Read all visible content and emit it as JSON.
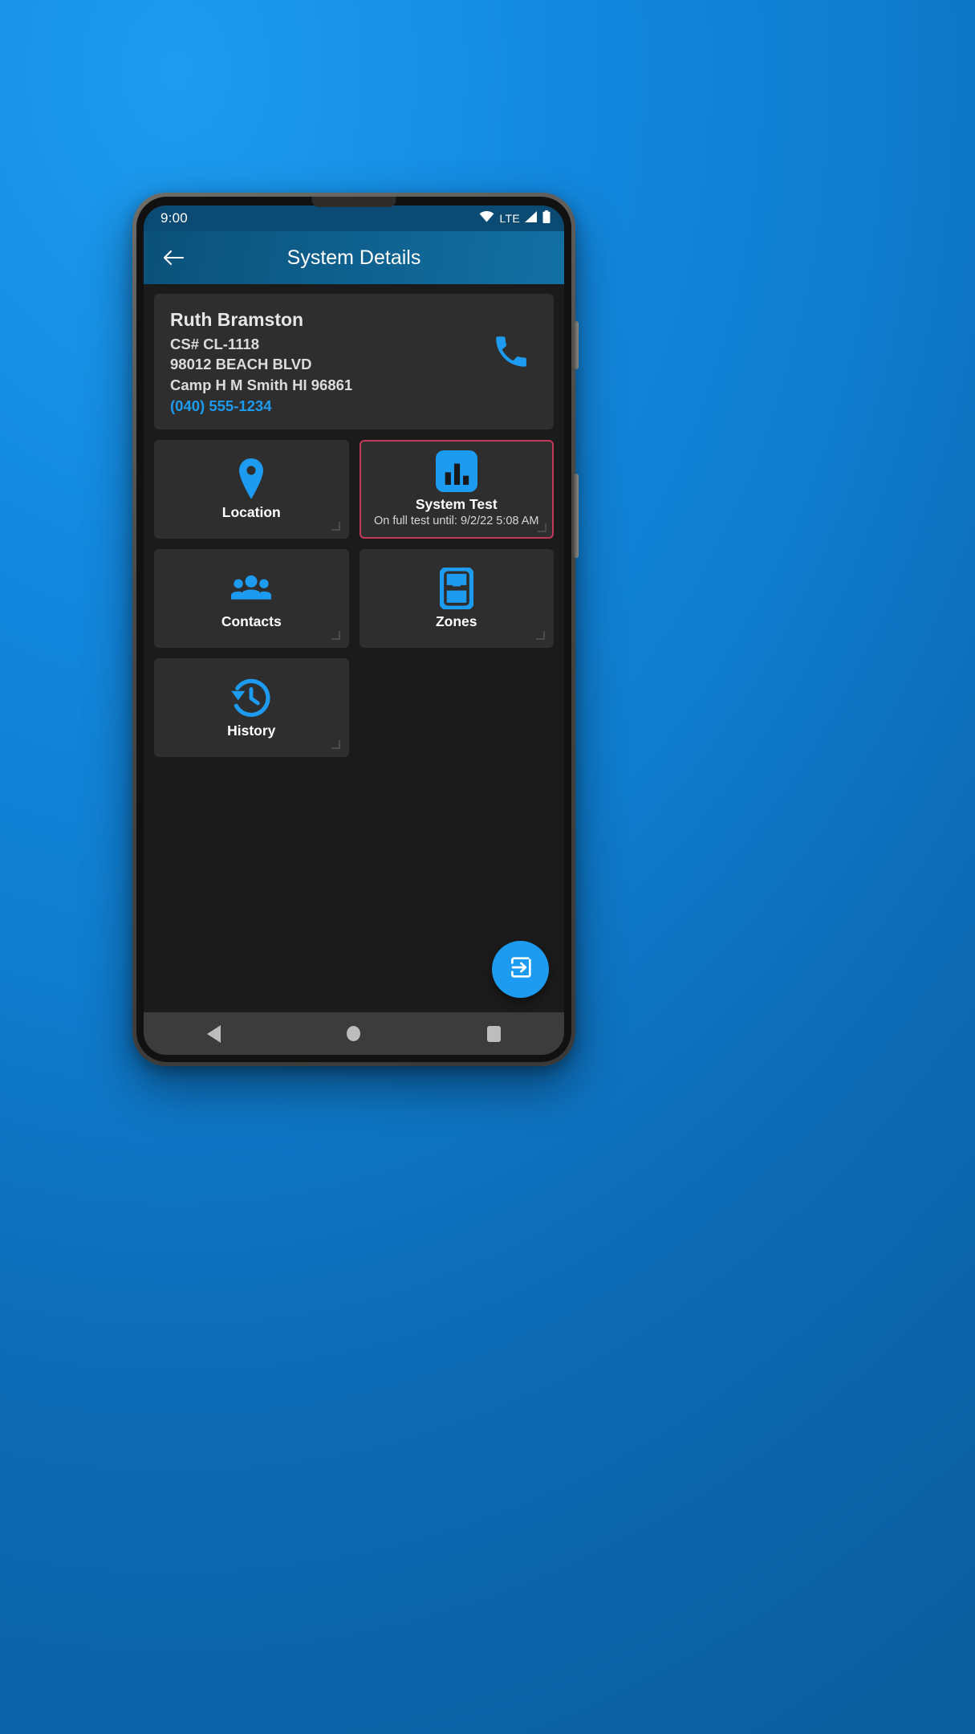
{
  "status_bar": {
    "time": "9:00",
    "network_label": "LTE",
    "icons": [
      "wifi-icon",
      "signal-icon",
      "battery-icon"
    ]
  },
  "app_bar": {
    "back_label": "back-arrow-icon",
    "title": "System Details"
  },
  "customer_card": {
    "name": "Ruth Bramston",
    "cs_number": "CS# CL-1118",
    "address_line1": "98012 BEACH BLVD",
    "address_line2": "Camp H M Smith HI 96861",
    "phone": "(040) 555-1234",
    "call_icon": "phone-icon"
  },
  "tiles": [
    {
      "id": "location",
      "label": "Location",
      "icon": "map-pin-icon",
      "subtitle": "",
      "alert": false
    },
    {
      "id": "system-test",
      "label": "System Test",
      "icon": "bar-chart-icon",
      "subtitle": "On full test until: 9/2/22 5:08 AM",
      "alert": true
    },
    {
      "id": "contacts",
      "label": "Contacts",
      "icon": "people-group-icon",
      "subtitle": "",
      "alert": false
    },
    {
      "id": "zones",
      "label": "Zones",
      "icon": "door-sensor-icon",
      "subtitle": "",
      "alert": false
    },
    {
      "id": "history",
      "label": "History",
      "icon": "history-clock-icon",
      "subtitle": "",
      "alert": false
    }
  ],
  "fab": {
    "icon": "login-arrow-icon",
    "label": ""
  },
  "nav_bar": {
    "back": "nav-back-icon",
    "home": "nav-home-icon",
    "recents": "nav-recents-icon"
  },
  "colors": {
    "accent": "#1d9bf0",
    "app_bar": "#0e5f8c",
    "status_bar": "#0b4a73",
    "alert_border": "#c2375a",
    "tile_bg": "#2e2e2e",
    "screen_bg": "#1b1b1c"
  }
}
